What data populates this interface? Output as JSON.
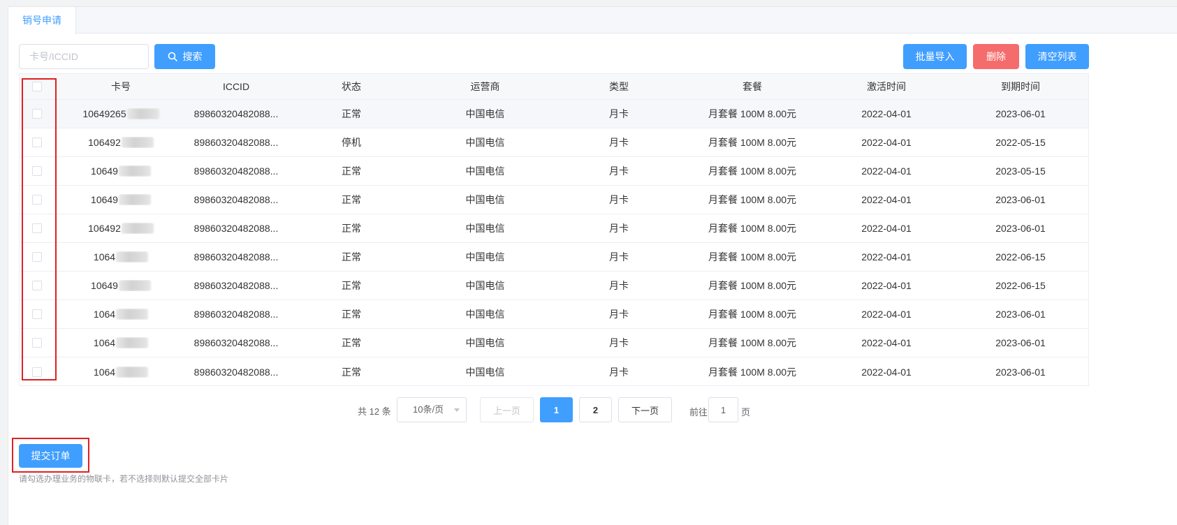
{
  "tabs": [
    {
      "label": "销号申请",
      "active": true
    }
  ],
  "toolbar": {
    "search_placeholder": "卡号/ICCID",
    "search_value": "",
    "search_label": "搜索",
    "import_label": "批量导入",
    "delete_label": "删除",
    "clear_label": "清空列表"
  },
  "table": {
    "headers": [
      "卡号",
      "ICCID",
      "状态",
      "运营商",
      "类型",
      "套餐",
      "激活时间",
      "到期时间"
    ],
    "rows": [
      {
        "card": "10649265",
        "iccid": "89860320482088...",
        "status": "正常",
        "operator": "中国电信",
        "type": "月卡",
        "package": "月套餐 100M 8.00元",
        "activated": "2022-04-01",
        "expires": "2023-06-01"
      },
      {
        "card": "106492",
        "iccid": "89860320482088...",
        "status": "停机",
        "operator": "中国电信",
        "type": "月卡",
        "package": "月套餐 100M 8.00元",
        "activated": "2022-04-01",
        "expires": "2022-05-15"
      },
      {
        "card": "10649",
        "iccid": "89860320482088...",
        "status": "正常",
        "operator": "中国电信",
        "type": "月卡",
        "package": "月套餐 100M 8.00元",
        "activated": "2022-04-01",
        "expires": "2023-05-15"
      },
      {
        "card": "10649",
        "iccid": "89860320482088...",
        "status": "正常",
        "operator": "中国电信",
        "type": "月卡",
        "package": "月套餐 100M 8.00元",
        "activated": "2022-04-01",
        "expires": "2023-06-01"
      },
      {
        "card": "106492",
        "iccid": "89860320482088...",
        "status": "正常",
        "operator": "中国电信",
        "type": "月卡",
        "package": "月套餐 100M 8.00元",
        "activated": "2022-04-01",
        "expires": "2023-06-01"
      },
      {
        "card": "1064",
        "iccid": "89860320482088...",
        "status": "正常",
        "operator": "中国电信",
        "type": "月卡",
        "package": "月套餐 100M 8.00元",
        "activated": "2022-04-01",
        "expires": "2022-06-15"
      },
      {
        "card": "10649",
        "iccid": "89860320482088...",
        "status": "正常",
        "operator": "中国电信",
        "type": "月卡",
        "package": "月套餐 100M 8.00元",
        "activated": "2022-04-01",
        "expires": "2022-06-15"
      },
      {
        "card": "1064",
        "iccid": "89860320482088...",
        "status": "正常",
        "operator": "中国电信",
        "type": "月卡",
        "package": "月套餐 100M 8.00元",
        "activated": "2022-04-01",
        "expires": "2023-06-01"
      },
      {
        "card": "1064",
        "iccid": "89860320482088...",
        "status": "正常",
        "operator": "中国电信",
        "type": "月卡",
        "package": "月套餐 100M 8.00元",
        "activated": "2022-04-01",
        "expires": "2023-06-01"
      },
      {
        "card": "1064",
        "iccid": "89860320482088...",
        "status": "正常",
        "operator": "中国电信",
        "type": "月卡",
        "package": "月套餐 100M 8.00元",
        "activated": "2022-04-01",
        "expires": "2023-06-01"
      }
    ]
  },
  "pagination": {
    "total_text": "共 12 条",
    "page_size": "10条/页",
    "prev": "上一页",
    "pages": [
      "1",
      "2"
    ],
    "current": "1",
    "next": "下一页",
    "goto_label": "前往",
    "goto_value": "1",
    "goto_suffix": "页"
  },
  "footer": {
    "submit_label": "提交订单",
    "hint": "请勾选办理业务的物联卡，若不选择则默认提交全部卡片"
  },
  "colors": {
    "primary": "#409eff",
    "danger": "#f56c6c",
    "highlight": "#e02020"
  }
}
